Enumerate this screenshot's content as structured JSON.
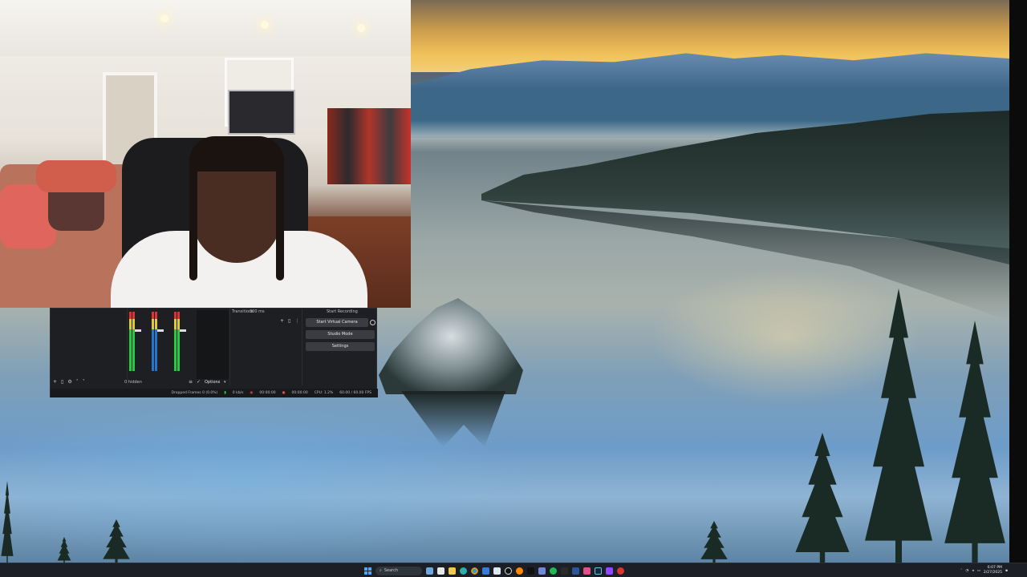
{
  "obs": {
    "transitions_title": "Transitions",
    "transitions_value": "300 ms",
    "controls_title": "Start Recording",
    "controls": [
      {
        "label": "Start Virtual Camera"
      },
      {
        "label": "Studio Mode"
      },
      {
        "label": "Settings"
      }
    ],
    "scenes_label": "0 hidden",
    "options_label": "Options",
    "status": {
      "dropped_frames": "Dropped Frames 0 (0.0%)",
      "bitrate": "0 kb/s",
      "streaming_time": "00:00:00",
      "recording_time": "00:00:00",
      "cpu": "CPU: 1.2%",
      "fps": "60.00 / 60.00 FPS"
    }
  },
  "taskbar": {
    "search_placeholder": "Search",
    "time": "6:07 PM",
    "date": "2/27/2025"
  },
  "colors": {
    "obs_bg": "#1e1f22",
    "meter_green": "#22cc44",
    "meter_blue": "#2277cc",
    "taskbar_bg": "#1c2026",
    "start_blue": "#4fa8ff"
  }
}
